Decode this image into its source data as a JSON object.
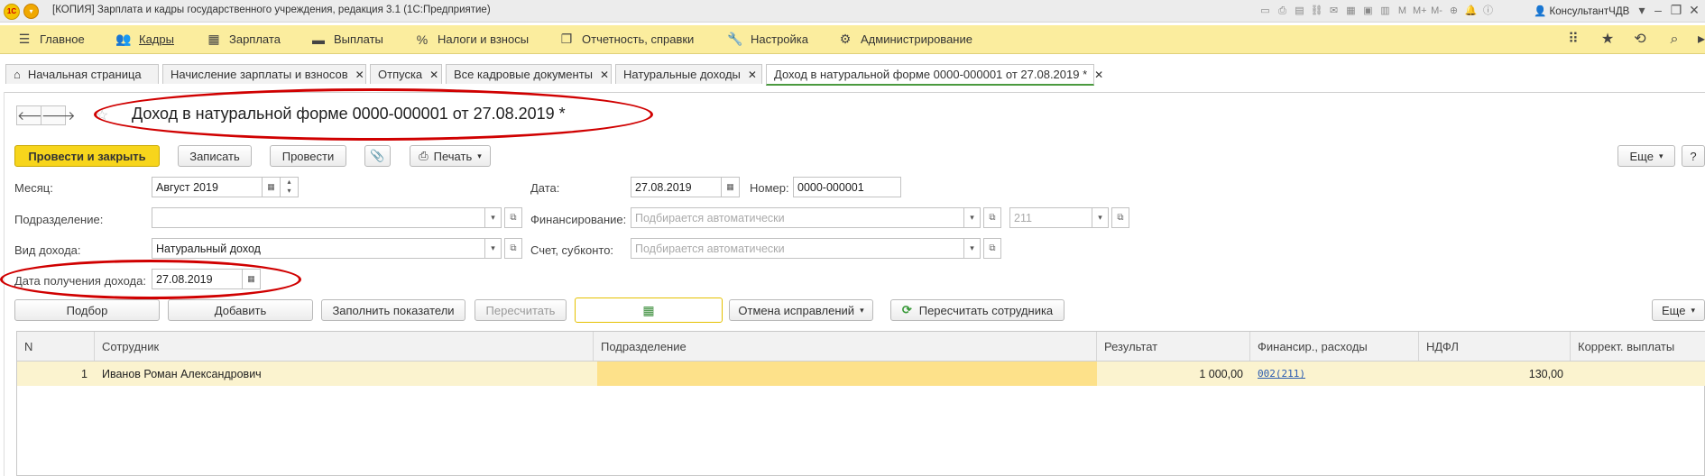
{
  "window": {
    "title": "[КОПИЯ] Зарплата и кадры государственного учреждения, редакция 3.1  (1С:Предприятие)",
    "logo_text": "1С",
    "user": "КонсультантЧДВ",
    "toolbar_letters": [
      "M",
      "M+",
      "M-"
    ]
  },
  "menu": {
    "items": [
      {
        "label": "Главное",
        "icon": "hamburger-icon"
      },
      {
        "label": "Кадры",
        "icon": "people-icon"
      },
      {
        "label": "Зарплата",
        "icon": "calculator-icon"
      },
      {
        "label": "Выплаты",
        "icon": "wallet-icon"
      },
      {
        "label": "Налоги и взносы",
        "icon": "percent-icon"
      },
      {
        "label": "Отчетность, справки",
        "icon": "reports-icon"
      },
      {
        "label": "Настройка",
        "icon": "wrench-icon"
      },
      {
        "label": "Администрирование",
        "icon": "gear-icon"
      }
    ]
  },
  "tabs": [
    {
      "label": "Начальная страница",
      "icon": "home-icon"
    },
    {
      "label": "Начисление зарплаты и взносов"
    },
    {
      "label": "Отпуска"
    },
    {
      "label": "Все кадровые документы"
    },
    {
      "label": "Натуральные доходы"
    },
    {
      "label": "Доход в натуральной форме 0000-000001 от 27.08.2019 *",
      "active": true
    }
  ],
  "document": {
    "title": "Доход в натуральной форме 0000-000001 от 27.08.2019 *"
  },
  "commands": {
    "post_close": "Провести и закрыть",
    "save": "Записать",
    "post": "Провести",
    "print": "Печать",
    "more": "Еще",
    "help": "?"
  },
  "form": {
    "month_label": "Месяц:",
    "month_value": "Август 2019",
    "date_label": "Дата:",
    "date_value": "27.08.2019",
    "number_label": "Номер:",
    "number_value": "0000-000001",
    "division_label": "Подразделение:",
    "division_value": "",
    "financing_label": "Финансирование:",
    "financing_placeholder": "Подбирается автоматически",
    "kosgu_value": "211",
    "income_type_label": "Вид дохода:",
    "income_type_value": "Натуральный доход",
    "account_label": "Счет, субконто:",
    "account_placeholder": "Подбирается автоматически",
    "income_date_label": "Дата получения дохода:",
    "income_date_value": "27.08.2019"
  },
  "table_toolbar": {
    "select": "Подбор",
    "add": "Добавить",
    "fill": "Заполнить показатели",
    "recalc": "Пересчитать",
    "cancel_fix": "Отмена исправлений",
    "recalc_employee": "Пересчитать сотрудника",
    "more": "Еще"
  },
  "table": {
    "columns": [
      "N",
      "Сотрудник",
      "Подразделение",
      "Результат",
      "Финансир., расходы",
      "НДФЛ",
      "Коррект. выплаты"
    ],
    "rows": [
      {
        "n": "1",
        "employee": "Иванов Роман Александрович",
        "division": "",
        "result": "1 000,00",
        "financing": "002(211)",
        "ndfl": "130,00",
        "correction": ""
      }
    ]
  },
  "colors": {
    "menu_bg": "#fbed9e",
    "primary_button": "#f7d51c",
    "highlight_ellipse": "#d00000",
    "active_tab_underline": "#4b9a3f"
  }
}
